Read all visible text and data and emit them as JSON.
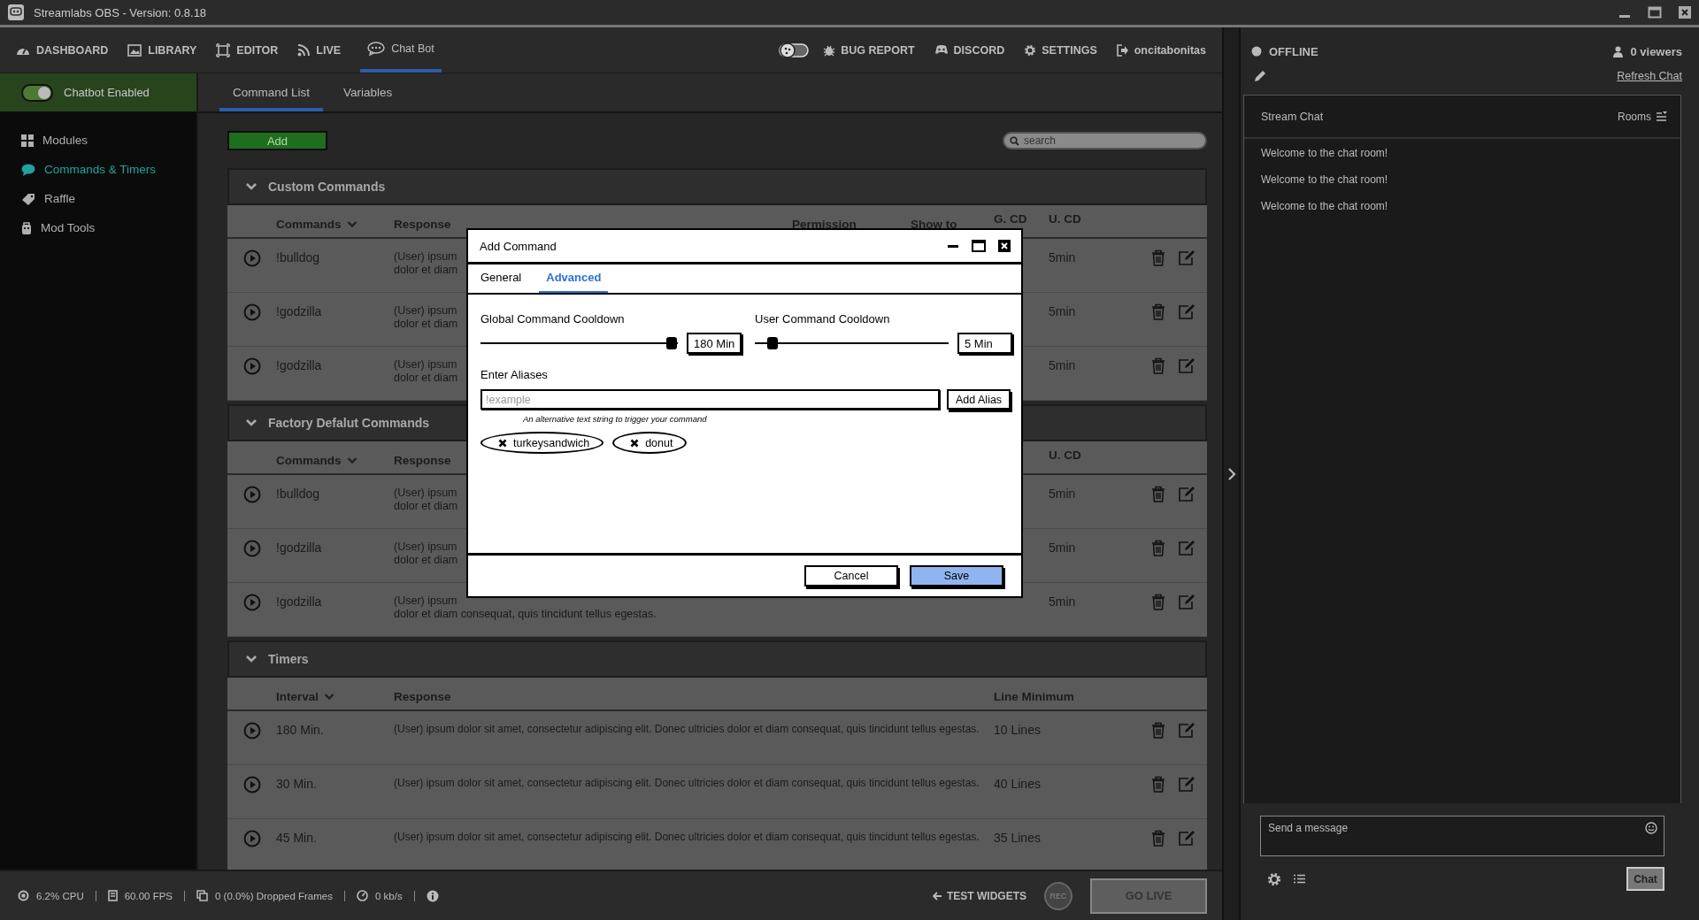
{
  "window": {
    "title": "Streamlabs OBS - Version: 0.8.18"
  },
  "nav": {
    "items": [
      {
        "label": "DASHBOARD",
        "selected": false
      },
      {
        "label": "LIBRARY",
        "selected": false
      },
      {
        "label": "EDITOR",
        "selected": false
      },
      {
        "label": "LIVE",
        "selected": false
      },
      {
        "label": "Chat Bot",
        "selected": true
      }
    ],
    "actions": [
      "BUG REPORT",
      "DISCORD",
      "SETTINGS",
      "oncitabonitas"
    ]
  },
  "sidebar": {
    "toggle": {
      "label": "Chatbot Enabled",
      "on": true
    },
    "items": [
      {
        "label": "Modules",
        "selected": false
      },
      {
        "label": "Commands & Timers",
        "selected": true
      },
      {
        "label": "Raffle",
        "selected": false
      },
      {
        "label": "Mod Tools",
        "selected": false
      }
    ]
  },
  "tabs": [
    {
      "label": "Command List",
      "selected": true
    },
    {
      "label": "Variables",
      "selected": false
    }
  ],
  "add_button": "Add",
  "search": {
    "placeholder": "search"
  },
  "sections": [
    {
      "kind": "commands",
      "title": "Custom Commands",
      "expanded": true,
      "columns": {
        "command": "Commands",
        "response": "Response",
        "permission": "Permission",
        "show_to": "Show to",
        "g_cd": "G. CD",
        "u_cd": "U. CD"
      },
      "rows": [
        {
          "command": "!bulldog",
          "response": [
            "(User) ipsum",
            "dolor et diam"
          ],
          "u_cd": "5min"
        },
        {
          "command": "!godzilla",
          "response": [
            "(User) ipsum",
            "dolor et diam"
          ],
          "u_cd": "5min"
        },
        {
          "command": "!godzilla",
          "response": [
            "(User) ipsum",
            "dolor et diam"
          ],
          "u_cd": "5min"
        }
      ]
    },
    {
      "kind": "commands",
      "title": "Factory Defalut Commands",
      "expanded": true,
      "columns": {
        "command": "Commands",
        "response": "Response",
        "u_cd": "U. CD"
      },
      "rows": [
        {
          "command": "!bulldog",
          "response": [
            "(User) ipsum",
            "dolor et diam"
          ],
          "u_cd": "5min"
        },
        {
          "command": "!godzilla",
          "response": [
            "(User) ipsum",
            "dolor et diam"
          ],
          "u_cd": "5min"
        },
        {
          "command": "!godzilla",
          "response": [
            "(User) ipsum",
            "dolor et diam consequat, quis tincidunt tellus egestas."
          ],
          "u_cd": "5min"
        }
      ]
    },
    {
      "kind": "timers",
      "title": "Timers",
      "expanded": true,
      "columns": {
        "interval": "Interval",
        "response": "Response",
        "line_minimum": "Line Minimum"
      },
      "rows": [
        {
          "interval": "180 Min.",
          "response": "(User) ipsum dolor sit amet, consectetur adipiscing elit. Donec ultricies dolor et diam consequat, quis tincidunt tellus egestas.",
          "line_minimum": "10 Lines"
        },
        {
          "interval": "30 Min.",
          "response": "(User) ipsum dolor sit amet, consectetur adipiscing elit. Donec ultricies dolor et diam consequat, quis tincidunt tellus egestas.",
          "line_minimum": "40 Lines"
        },
        {
          "interval": "45 Min.",
          "response": "(User) ipsum dolor sit amet, consectetur adipiscing elit. Donec ultricies dolor et diam consequat, quis tincidunt tellus egestas.",
          "line_minimum": "35 Lines"
        }
      ]
    }
  ],
  "modal": {
    "title": "Add Command",
    "tabs": [
      {
        "label": "General",
        "selected": false
      },
      {
        "label": "Advanced",
        "selected": true
      }
    ],
    "cooldowns": [
      {
        "label": "Global Command Cooldown",
        "level": 0.97,
        "value": "180 Min"
      },
      {
        "label": "User Command Cooldown",
        "level": 0.09,
        "value": "5 Min"
      }
    ],
    "aliases": {
      "label": "Enter Aliases",
      "placeholder": "!example",
      "button": "Add Alias",
      "hint": "An alternative text string to trigger your command",
      "chips": [
        "turkeysandwich",
        "donut"
      ]
    },
    "buttons": [
      {
        "label": "Cancel",
        "kind": "secondary"
      },
      {
        "label": "Save",
        "kind": "primary"
      }
    ]
  },
  "status_bar": {
    "cpu": "6.2% CPU",
    "fps": "60.00 FPS",
    "dropped": "0 (0.0%) Dropped Frames",
    "bandwidth": "0 kb/s",
    "test_widgets": "TEST WIDGETS",
    "rec": "REC",
    "go_live": "GO LIVE"
  },
  "chat": {
    "status": "OFFLINE",
    "viewers": "0 viewers",
    "refresh": "Refresh Chat",
    "title": "Stream Chat",
    "rooms": "Rooms",
    "messages": [
      "Welcome to the chat room!",
      "Welcome to the chat room!",
      "Welcome to the chat room!"
    ],
    "input": {
      "placeholder": "Send a message"
    },
    "send": "Chat"
  }
}
